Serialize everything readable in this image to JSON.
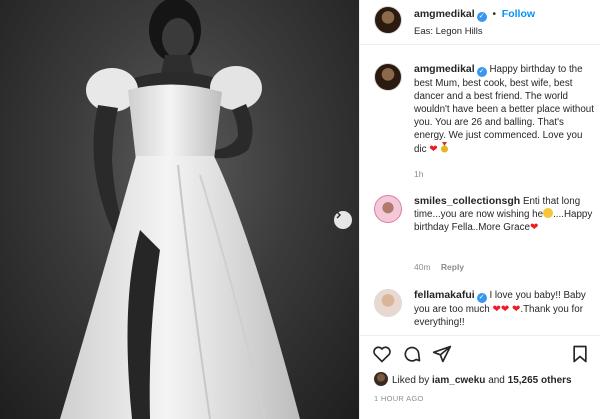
{
  "post": {
    "username": "amgmedikal",
    "follow_label": "Follow",
    "bullet": "•",
    "location": "Eas: Legon Hills"
  },
  "caption": {
    "username": "amgmedikal",
    "text": "Happy birthday to the best Mum, best cook, best wife, best dancer and a best friend. The world wouldn't have been a better place without you. You are 26 and balling. That's energy. We just commenced. Love you dic",
    "time": "1h"
  },
  "comments": [
    {
      "username": "smiles_collectionsgh",
      "text_a": "Enti that long time...you are now wishing he",
      "text_b": "....Happy birthday Fella..More Grace",
      "time": "40m",
      "reply_label": "Reply"
    },
    {
      "username": "fellamakafui",
      "text_a": "I love you baby!! Baby you are too much",
      "text_b": ".Thank you for everything!!"
    }
  ],
  "likes": {
    "prefix": "Liked by",
    "user": "iam_cweku",
    "middle": "and",
    "count": "15,265 others"
  },
  "timestamp": "1 HOUR AGO",
  "colors": {
    "link": "#0095f6",
    "heart": "#ed1c24",
    "verified": "#3897f0"
  }
}
